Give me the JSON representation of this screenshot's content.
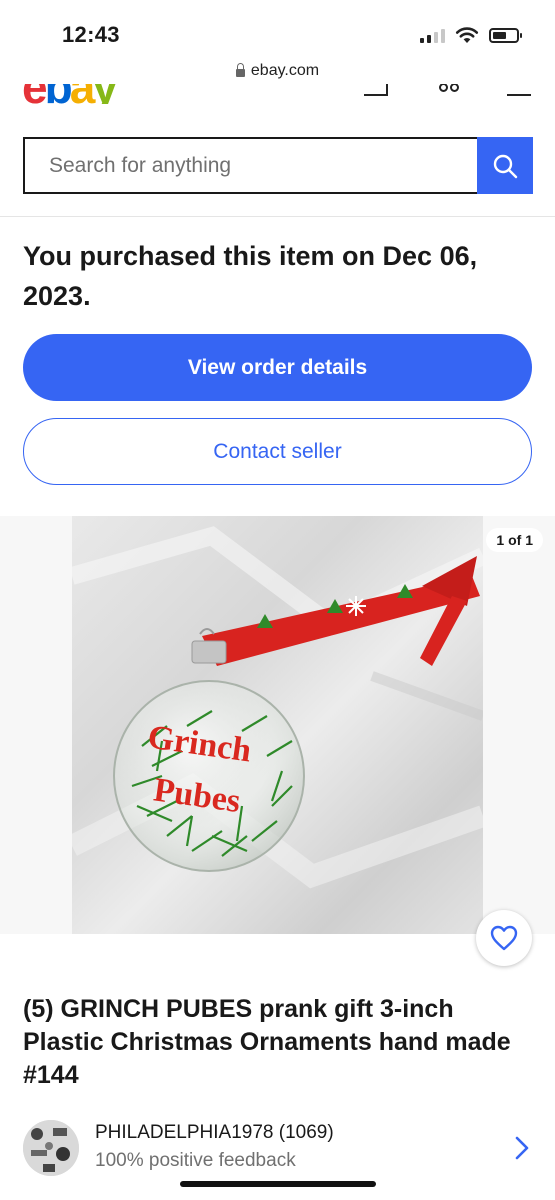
{
  "status_bar": {
    "time": "12:43",
    "icons": [
      "cellular-signal-icon",
      "wifi-icon",
      "battery-icon"
    ]
  },
  "browser": {
    "url": "ebay.com",
    "lock_icon": "lock-icon"
  },
  "header": {
    "logo": [
      "e",
      "b",
      "a",
      "y"
    ],
    "icons": [
      "bell-icon",
      "cart-icon",
      "menu-icon"
    ]
  },
  "search": {
    "placeholder": "Search for anything",
    "button_icon": "search-icon"
  },
  "purchase": {
    "message": "You purchased this item on Dec 06, 2023.",
    "view_order_label": "View order details",
    "contact_seller_label": "Contact seller"
  },
  "gallery": {
    "counter": "1 of 1",
    "ornament_text_line1": "Grinch",
    "ornament_text_line2": "Pubes",
    "favorite_icon": "heart-icon"
  },
  "listing": {
    "title": "(5) GRINCH PUBES prank gift 3-inch Plastic Christmas Ornaments hand made #144"
  },
  "seller": {
    "name_and_score": "PHILADELPHIA1978 (1069)",
    "feedback": "100% positive feedback",
    "chevron_icon": "chevron-right-icon"
  },
  "colors": {
    "primary": "#3665f3",
    "text": "#191919",
    "secondary_text": "#707070",
    "ornament_text": "#d9281f",
    "tinsel": "#2f8a2a",
    "ribbon": "#d8231f"
  }
}
